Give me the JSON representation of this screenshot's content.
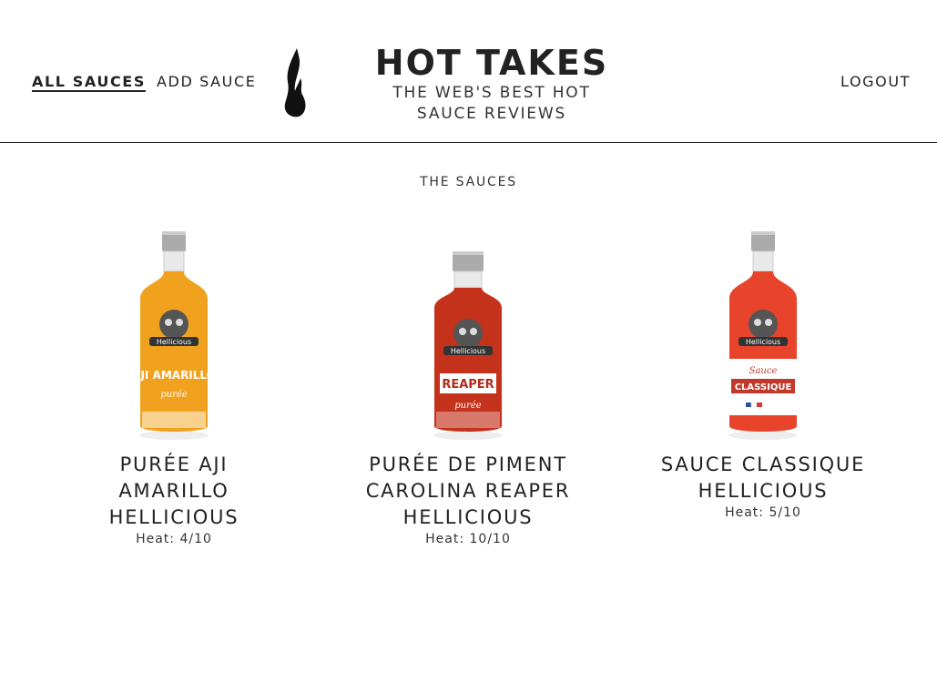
{
  "nav": {
    "all_sauces": "ALL SAUCES",
    "add_sauce": "ADD SAUCE",
    "logout": "LOGOUT"
  },
  "brand": {
    "title": "HOT TAKES",
    "subtitle": "THE WEB'S BEST HOT SAUCE REVIEWS",
    "logo_icon": "flame-icon"
  },
  "main": {
    "heading": "THE SAUCES",
    "sauces": [
      {
        "name": "PURÉE AJI AMARILLO HELLICIOUS",
        "heat": "Heat: 4/10",
        "bottle": {
          "color": "#f0a21e",
          "label_text": "AJI AMARILLO",
          "sub_text": "purée",
          "brand": "Hellicious"
        }
      },
      {
        "name": "PURÉE DE PIMENT CAROLINA REAPER HELLICIOUS",
        "heat": "Heat: 10/10",
        "bottle": {
          "color": "#c4321c",
          "label_text": "REAPER",
          "sub_text": "purée",
          "brand": "Hellicious"
        }
      },
      {
        "name": "SAUCE CLASSIQUE HELLICIOUS",
        "heat": "Heat: 5/10",
        "bottle": {
          "color": "#e8442c",
          "label_text": "CLASSIQUE",
          "sub_text": "Sauce",
          "brand": "Hellicious"
        }
      }
    ]
  }
}
